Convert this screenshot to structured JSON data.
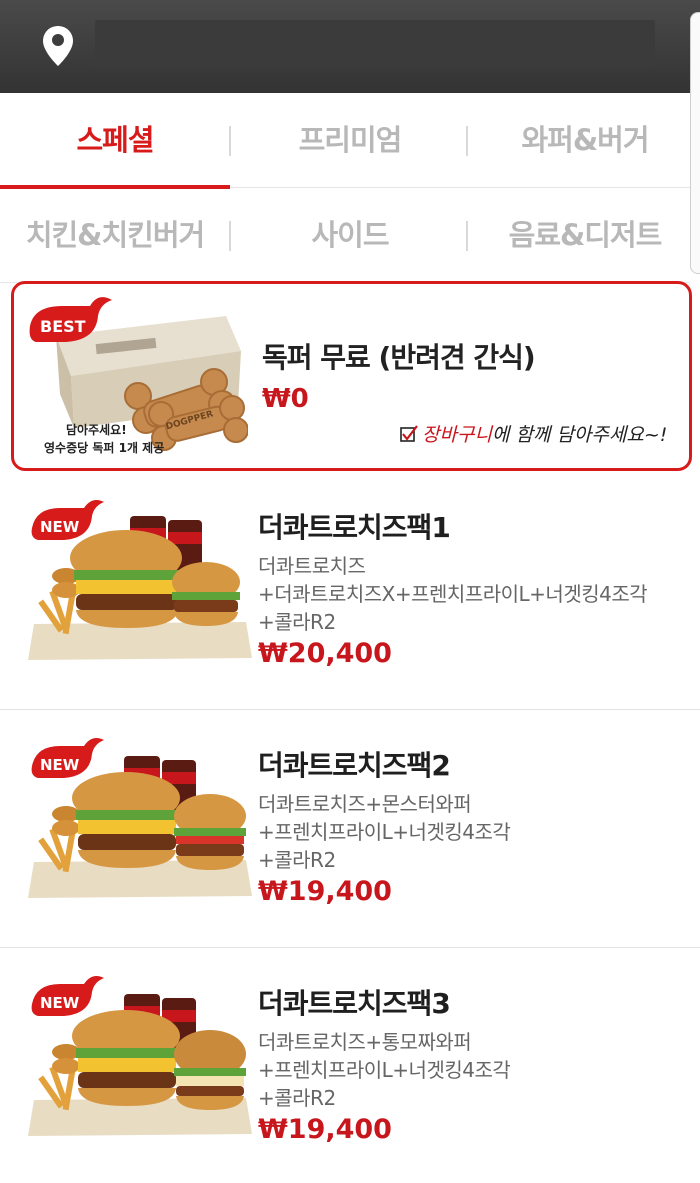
{
  "header": {
    "address": "",
    "location_icon": "location-pin-icon"
  },
  "tabs": {
    "row1": [
      "스페셜",
      "프리미엄",
      "와퍼&버거"
    ],
    "row2": [
      "치킨&치킨버거",
      "사이드",
      "음료&디저트"
    ],
    "active": "스페셜"
  },
  "featured": {
    "badge": "BEST",
    "box_label": "DOGPPER",
    "img_caption_1": "담아주세요!",
    "img_caption_2": "영수증당 독퍼 1개 제공",
    "title": "독퍼 무료 (반려견 간식)",
    "price": "₩0",
    "note_highlight": "장바구니",
    "note_rest": "에 함께 담아주세요~!"
  },
  "products": [
    {
      "badge": "NEW",
      "name": "더콰트로치즈팩1",
      "desc": [
        "더콰트로치즈",
        "+더콰트로치즈X+프렌치프라이L+너겟킹4조각",
        "+콜라R2"
      ],
      "price": "₩20,400"
    },
    {
      "badge": "NEW",
      "name": "더콰트로치즈팩2",
      "desc": [
        "더콰트로치즈+몬스터와퍼",
        "+프렌치프라이L+너겟킹4조각",
        "+콜라R2"
      ],
      "price": "₩19,400"
    },
    {
      "badge": "NEW",
      "name": "더콰트로치즈팩3",
      "desc": [
        "더콰트로치즈+통모짜와퍼",
        "+프렌치프라이L+너겟킹4조각",
        "+콜라R2"
      ],
      "price": "₩19,400"
    }
  ],
  "colors": {
    "accent": "#d71b1b",
    "price": "#c8161d",
    "header_bg": "#3b3b3b",
    "inactive_tab": "#b8b8b8"
  }
}
